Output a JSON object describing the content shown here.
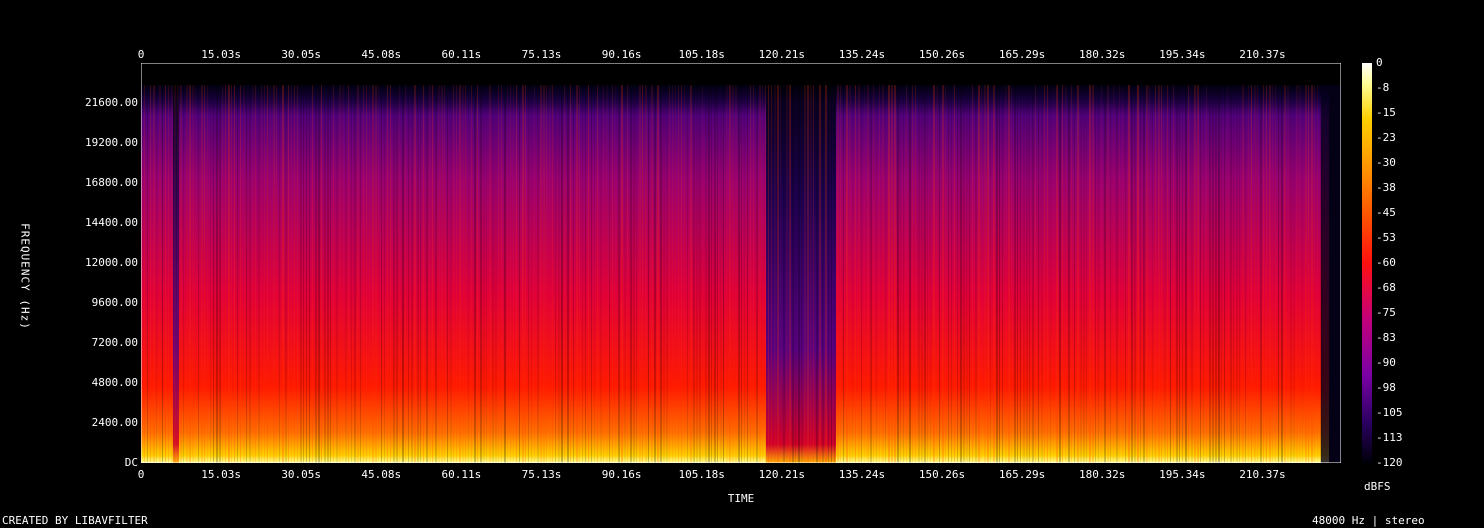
{
  "chart_data": {
    "type": "heatmap",
    "xlabel": "TIME",
    "ylabel": "FREQUENCY (Hz)",
    "x_ticks": [
      "0",
      "15.03s",
      "30.05s",
      "45.08s",
      "60.11s",
      "75.13s",
      "90.16s",
      "105.18s",
      "120.21s",
      "135.24s",
      "150.26s",
      "165.29s",
      "180.32s",
      "195.34s",
      "210.37s"
    ],
    "y_ticks": [
      "DC",
      "2400.00",
      "4800.00",
      "7200.00",
      "9600.00",
      "12000.00",
      "14400.00",
      "16800.00",
      "19200.00",
      "21600.00"
    ],
    "colorbar_ticks": [
      "0",
      "-8",
      "-15",
      "-23",
      "-30",
      "-38",
      "-45",
      "-53",
      "-60",
      "-68",
      "-75",
      "-83",
      "-90",
      "-98",
      "-105",
      "-113",
      "-120"
    ],
    "colorbar_label": "dBFS",
    "zlim": [
      -120,
      0
    ],
    "xlim": [
      0,
      225.4
    ],
    "ylim": [
      0,
      24000
    ]
  },
  "footer": {
    "left": "CREATED BY LIBAVFILTER",
    "right": "48000 Hz | stereo"
  },
  "colors": {
    "background": "#000000",
    "text": "#ffffff"
  }
}
